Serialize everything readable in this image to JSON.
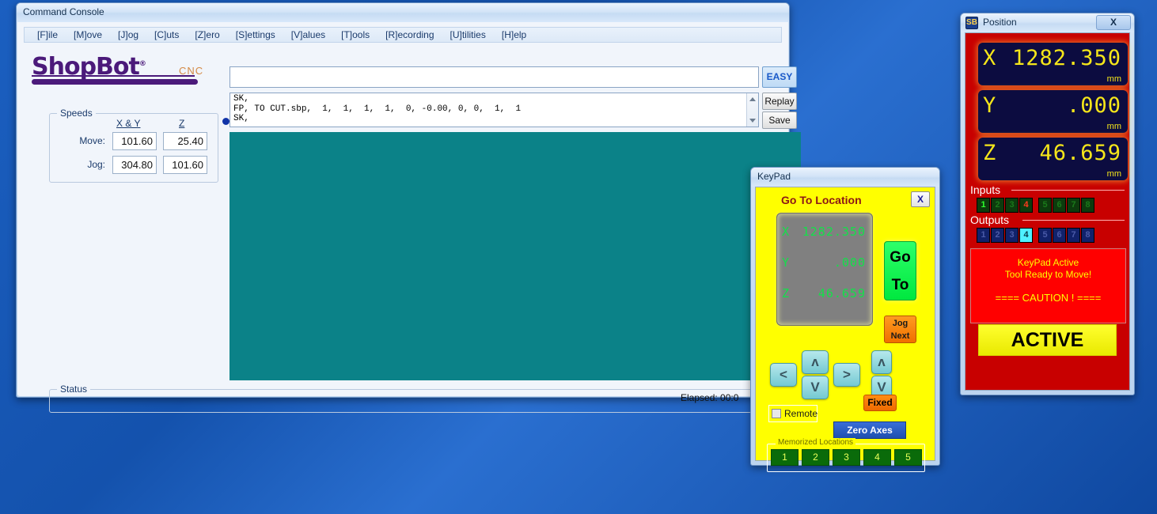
{
  "desktop": {
    "bg_color": "#1452ad"
  },
  "command_console": {
    "title": "Command Console",
    "menu": [
      "[F]ile",
      "[M]ove",
      "[J]og",
      "[C]uts",
      "[Z]ero",
      "[S]ettings",
      "[V]alues",
      "[T]ools",
      "[R]ecording",
      "[U]tilities",
      "[H]elp"
    ],
    "logo": {
      "text": "ShopBot",
      "registered": "®",
      "sub": "CNC"
    },
    "speeds": {
      "group_label": "Speeds",
      "col_headers": [
        "X & Y",
        "Z"
      ],
      "rows": [
        {
          "label": "Move:",
          "xy": "101.60",
          "z": "25.40"
        },
        {
          "label": "Jog:",
          "xy": "304.80",
          "z": "101.60"
        }
      ]
    },
    "command_input": {
      "value": "",
      "placeholder": ""
    },
    "easy_button": "EASY",
    "log_lines": [
      "SK,",
      "FP, TO CUT.sbp,  1,  1,  1,  1,  0, -0.00, 0, 0,  1,  1",
      "SK,"
    ],
    "replay_button": "Replay",
    "save_button": "Save",
    "status": {
      "group_label": "Status",
      "text": ""
    },
    "elapsed": "Elapsed: 00:0",
    "preview_color": "#0b8288"
  },
  "keypad": {
    "title": "KeyPad",
    "heading": "Go To Location",
    "close_label": "X",
    "lcd": {
      "rows": [
        {
          "axis": "X",
          "value": "1282.350"
        },
        {
          "axis": "Y",
          "value": ".000"
        },
        {
          "axis": "Z",
          "value": "46.659"
        }
      ]
    },
    "goto_button": "Go To",
    "jog_next_button": "Jog Next",
    "arrows": {
      "left": "<",
      "right": ">",
      "up": "ʌ",
      "down": "V",
      "z_up": "ʌ",
      "z_down": "V"
    },
    "fixed_button": "Fixed",
    "remote_checkbox": {
      "label": "Remote",
      "checked": false
    },
    "zero_axes_button": "Zero Axes",
    "memorized": {
      "label": "Memorized Locations",
      "buttons": [
        "1",
        "2",
        "3",
        "4",
        "5"
      ]
    }
  },
  "position": {
    "title": "Position",
    "close_label": "X",
    "units": "mm",
    "dro": [
      {
        "axis": "X",
        "value": "1282.350",
        "unit": "mm"
      },
      {
        "axis": "Y",
        "value": ".000",
        "unit": "mm"
      },
      {
        "axis": "Z",
        "value": "46.659",
        "unit": "mm"
      }
    ],
    "inputs": {
      "label": "Inputs",
      "cells": [
        {
          "n": "1",
          "state": "on"
        },
        {
          "n": "2",
          "state": "off"
        },
        {
          "n": "3",
          "state": "off"
        },
        {
          "n": "4",
          "state": "alarm"
        },
        {
          "n": "5",
          "state": "off"
        },
        {
          "n": "6",
          "state": "off"
        },
        {
          "n": "7",
          "state": "off"
        },
        {
          "n": "8",
          "state": "off"
        }
      ]
    },
    "outputs": {
      "label": "Outputs",
      "cells": [
        {
          "n": "1",
          "state": "off"
        },
        {
          "n": "2",
          "state": "off"
        },
        {
          "n": "3",
          "state": "off"
        },
        {
          "n": "4",
          "state": "on"
        },
        {
          "n": "5",
          "state": "off"
        },
        {
          "n": "6",
          "state": "off"
        },
        {
          "n": "7",
          "state": "off"
        },
        {
          "n": "8",
          "state": "off"
        }
      ]
    },
    "caution": {
      "line1": "KeyPad Active",
      "line2": "Tool Ready to Move!",
      "line3": "==== CAUTION ! ===="
    },
    "active_button": "ACTIVE"
  }
}
